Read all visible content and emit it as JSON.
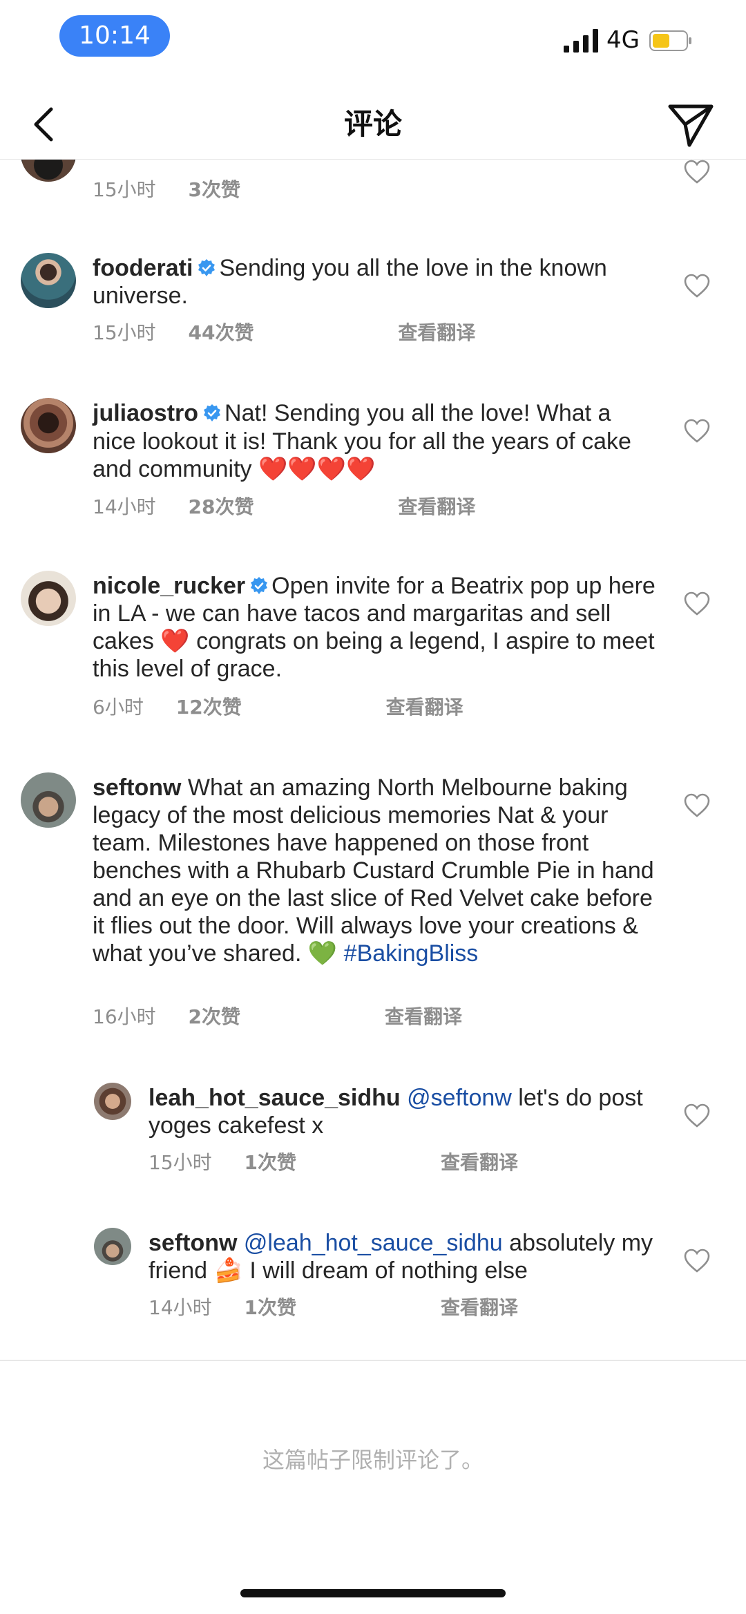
{
  "status_bar": {
    "time": "10:14",
    "network": "4G"
  },
  "header": {
    "title": "评论"
  },
  "comments": [
    {
      "username": "",
      "text": "",
      "time": "15小时",
      "likes": "3次赞",
      "translate": ""
    },
    {
      "username": "fooderati",
      "verified": true,
      "text": "Sending you all the love in the known universe.",
      "time": "15小时",
      "likes": "44次赞",
      "translate": "查看翻译"
    },
    {
      "username": "juliaostro",
      "verified": true,
      "text": "Nat! Sending you all the love! What a nice lookout it is! Thank you for all the years of cake and community",
      "emoji": "❤️❤️❤️❤️",
      "time": "14小时",
      "likes": "28次赞",
      "translate": "查看翻译"
    },
    {
      "username": "nicole_rucker",
      "verified": true,
      "text_before": "Open invite for a Beatrix pop up here in LA - we can have tacos and margaritas and sell cakes",
      "emoji": "❤️",
      "text_after": "congrats on being a legend, I aspire to meet this level of grace.",
      "time": "6小时",
      "likes": "12次赞",
      "translate": "查看翻译"
    },
    {
      "username": "seftonw",
      "verified": false,
      "text": "What an amazing North Melbourne baking legacy of the most delicious memories Nat & your team. Milestones have happened on those front benches with a Rhubarb Custard Crumble Pie in hand and an eye on the last slice of Red Velvet cake before it flies out the door. Will always love your creations & what you’ve shared.",
      "emoji": "💚",
      "hashtag": "#BakingBliss",
      "time": "16小时",
      "likes": "2次赞",
      "translate": "查看翻译"
    },
    {
      "username": "leah_hot_sauce_sidhu",
      "verified": false,
      "mention": "@seftonw",
      "text": "let's do post yoges cakefest x",
      "time": "15小时",
      "likes": "1次赞",
      "translate": "查看翻译"
    },
    {
      "username": "seftonw",
      "verified": false,
      "mention": "@leah_hot_sauce_sidhu",
      "text_before": "absolutely my friend",
      "emoji": "🍰",
      "text_after": "I will dream of nothing else",
      "time": "14小时",
      "likes": "1次赞",
      "translate": "查看翻译"
    }
  ],
  "footer": {
    "restricted_text": "这篇帖子限制评论了。"
  },
  "colors": {
    "time_pill": "#3a82f7",
    "verified_badge": "#3897f0",
    "link": "#1a4ea3",
    "meta_text": "#8e8e8e"
  },
  "icons": {
    "back": "chevron-left-icon",
    "share": "paper-plane-icon",
    "like": "heart-outline-icon",
    "verified": "verified-badge-icon"
  }
}
